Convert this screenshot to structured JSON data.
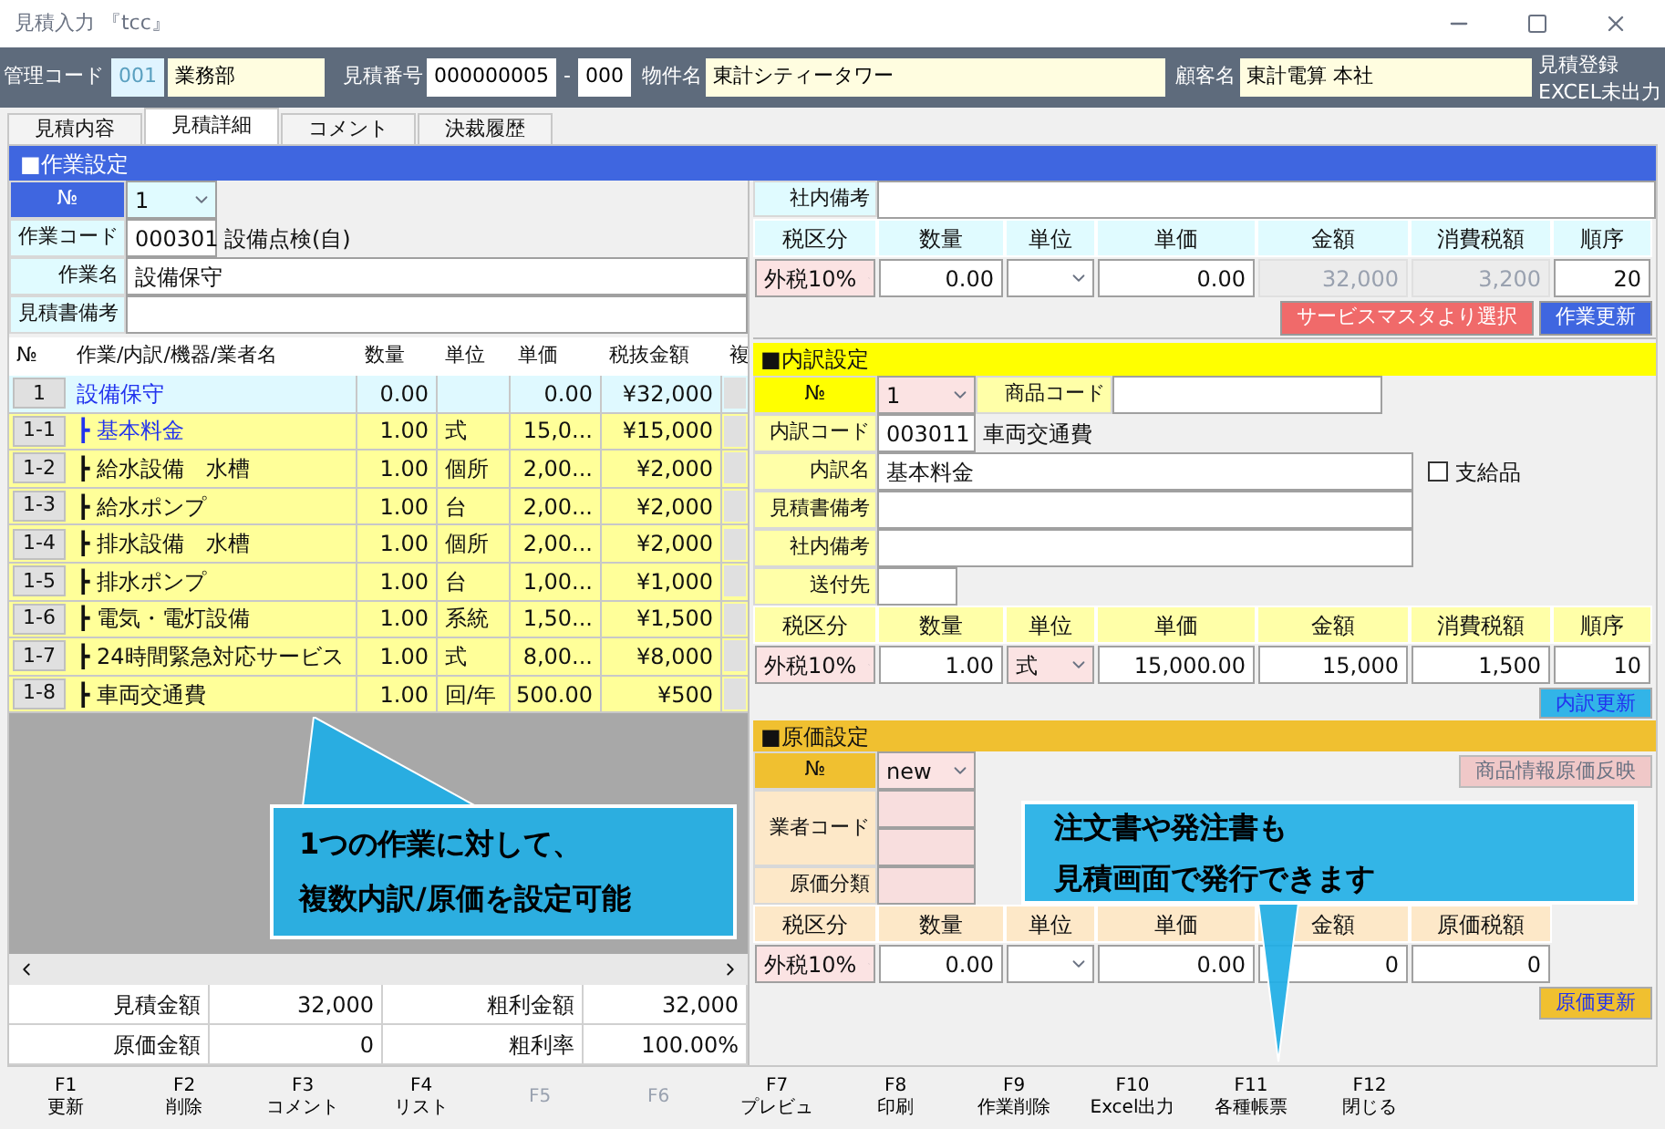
{
  "window": {
    "title": "見積入力 『tcc』"
  },
  "header": {
    "mgmt_label": "管理コード",
    "mgmt_code": "001",
    "dept": "業務部",
    "est_label": "見積番号",
    "est_no": "000000005",
    "sep": "-",
    "est_sub": "000",
    "property_label": "物件名",
    "property": "東計シティータワー",
    "customer_label": "顧客名",
    "customer": "東計電算 本社",
    "status": [
      "見積登録",
      "EXCEL未出力"
    ]
  },
  "tabs": [
    {
      "label": "見積内容",
      "selected": false
    },
    {
      "label": "見積詳細",
      "selected": true
    },
    {
      "label": "コメント",
      "selected": false
    },
    {
      "label": "決裁履歴",
      "selected": false
    }
  ],
  "work": {
    "title": "■作業設定",
    "no_label": "№",
    "no": "1",
    "code_label": "作業コード",
    "code": "000301",
    "code_name": "設備点検(自)",
    "name_label": "作業名",
    "name": "設備保守",
    "remark_label": "見積書備考",
    "internal_label": "社内備考",
    "headers": [
      "税区分",
      "数量",
      "単位",
      "単価",
      "金額",
      "消費税額",
      "順序"
    ],
    "values": [
      {
        "kind": "select",
        "text": "外税10%"
      },
      {
        "kind": "input",
        "text": "0.00"
      },
      {
        "kind": "select"
      },
      {
        "kind": "input",
        "text": "0.00"
      },
      {
        "kind": "readonly",
        "text": "32,000"
      },
      {
        "kind": "readonly",
        "text": "3,200"
      },
      {
        "kind": "input",
        "text": "20"
      }
    ],
    "buttons": [
      {
        "label": "サービスマスタより選択",
        "color": "#f06a6a"
      },
      {
        "label": "作業更新",
        "color": "#3f66e0"
      }
    ]
  },
  "table": {
    "columns": [
      "№",
      "作業/内訳/機器/業者名",
      "数量",
      "単位",
      "単価",
      "税抜金額",
      "複"
    ],
    "rows": [
      {
        "kind": "work",
        "selected": true,
        "cells": [
          "1",
          "設備保守",
          "0.00",
          "",
          "0.00",
          "¥32,000"
        ]
      },
      {
        "kind": "detail",
        "selected": true,
        "cells": [
          "1-1",
          "┣ 基本料金",
          "1.00",
          "式",
          "15,0...",
          "¥15,000"
        ]
      },
      {
        "kind": "detail",
        "selected": false,
        "cells": [
          "1-2",
          "┣ 給水設備　水槽",
          "1.00",
          "個所",
          "2,00...",
          "¥2,000"
        ]
      },
      {
        "kind": "detail",
        "selected": false,
        "cells": [
          "1-3",
          "┣ 給水ポンプ",
          "1.00",
          "台",
          "2,00...",
          "¥2,000"
        ]
      },
      {
        "kind": "detail",
        "selected": false,
        "cells": [
          "1-4",
          "┣ 排水設備　水槽",
          "1.00",
          "個所",
          "2,00...",
          "¥2,000"
        ]
      },
      {
        "kind": "detail",
        "selected": false,
        "cells": [
          "1-5",
          "┣ 排水ポンプ",
          "1.00",
          "台",
          "1,00...",
          "¥1,000"
        ]
      },
      {
        "kind": "detail",
        "selected": false,
        "cells": [
          "1-6",
          "┣ 電気・電灯設備",
          "1.00",
          "系統",
          "1,50...",
          "¥1,500"
        ]
      },
      {
        "kind": "detail",
        "selected": false,
        "cells": [
          "1-7",
          "┣ 24時間緊急対応サービス",
          "1.00",
          "式",
          "8,00...",
          "¥8,000"
        ]
      },
      {
        "kind": "detail",
        "selected": false,
        "cells": [
          "1-8",
          "┣ 車両交通費",
          "1.00",
          "回/年",
          "500.00",
          "¥500"
        ]
      }
    ]
  },
  "summary": [
    [
      "見積金額",
      "32,000",
      "粗利金額",
      "32,000"
    ],
    [
      "原価金額",
      "0",
      "粗利率",
      "100.00%"
    ]
  ],
  "detail": {
    "title": "■内訳設定",
    "no_label": "№",
    "no": "1",
    "product_label": "商品コード",
    "code_label": "内訳コード",
    "code": "003011",
    "code_name": "車両交通費",
    "name_label": "内訳名",
    "name": "基本料金",
    "supplied": {
      "label": "支給品",
      "checked": false
    },
    "remark_label": "見積書備考",
    "internal_label": "社内備考",
    "dest_label": "送付先",
    "headers": [
      "税区分",
      "数量",
      "単位",
      "単価",
      "金額",
      "消費税額",
      "順序"
    ],
    "values": [
      {
        "kind": "select",
        "text": "外税10%"
      },
      {
        "kind": "input",
        "text": "1.00"
      },
      {
        "kind": "select",
        "text": "式"
      },
      {
        "kind": "input",
        "text": "15,000.00"
      },
      {
        "kind": "input",
        "text": "15,000"
      },
      {
        "kind": "input",
        "text": "1,500"
      },
      {
        "kind": "input",
        "text": "10"
      }
    ],
    "button": "内訳更新"
  },
  "cost": {
    "title": "■原価設定",
    "no_label": "№",
    "no": "new",
    "vendor_label": "業者コード",
    "class_label": "原価分類",
    "headers": [
      "税区分",
      "数量",
      "単位",
      "単価",
      "金額",
      "原価税額"
    ],
    "values": [
      {
        "kind": "select",
        "text": "外税10%"
      },
      {
        "kind": "input",
        "text": "0.00"
      },
      {
        "kind": "select"
      },
      {
        "kind": "input",
        "text": "0.00"
      },
      {
        "kind": "input",
        "text": "0"
      },
      {
        "kind": "input",
        "text": "0"
      }
    ],
    "reflect_button": "商品情報原価反映",
    "button": "原価更新"
  },
  "function_keys": [
    {
      "key": "F1",
      "label": "更新",
      "disabled": false
    },
    {
      "key": "F2",
      "label": "削除",
      "disabled": false
    },
    {
      "key": "F3",
      "label": "コメント",
      "disabled": false
    },
    {
      "key": "F4",
      "label": "リスト",
      "disabled": false
    },
    {
      "key": "F5",
      "disabled": true
    },
    {
      "key": "F6",
      "disabled": true
    },
    {
      "key": "F7",
      "label": "プレビュ",
      "disabled": false
    },
    {
      "key": "F8",
      "label": "印刷",
      "disabled": false
    },
    {
      "key": "F9",
      "label": "作業削除",
      "disabled": false
    },
    {
      "key": "F10",
      "label": "Excel出力",
      "disabled": false
    },
    {
      "key": "F11",
      "label": "各種帳票",
      "disabled": false
    },
    {
      "key": "F12",
      "label": "閉じる",
      "disabled": false
    }
  ],
  "callouts": [
    {
      "lines": [
        "1つの作業に対して、",
        "複数内訳/原価を設定可能"
      ]
    },
    {
      "lines": [
        "注文書や発注書も",
        "見積画面で発行できます"
      ]
    }
  ]
}
